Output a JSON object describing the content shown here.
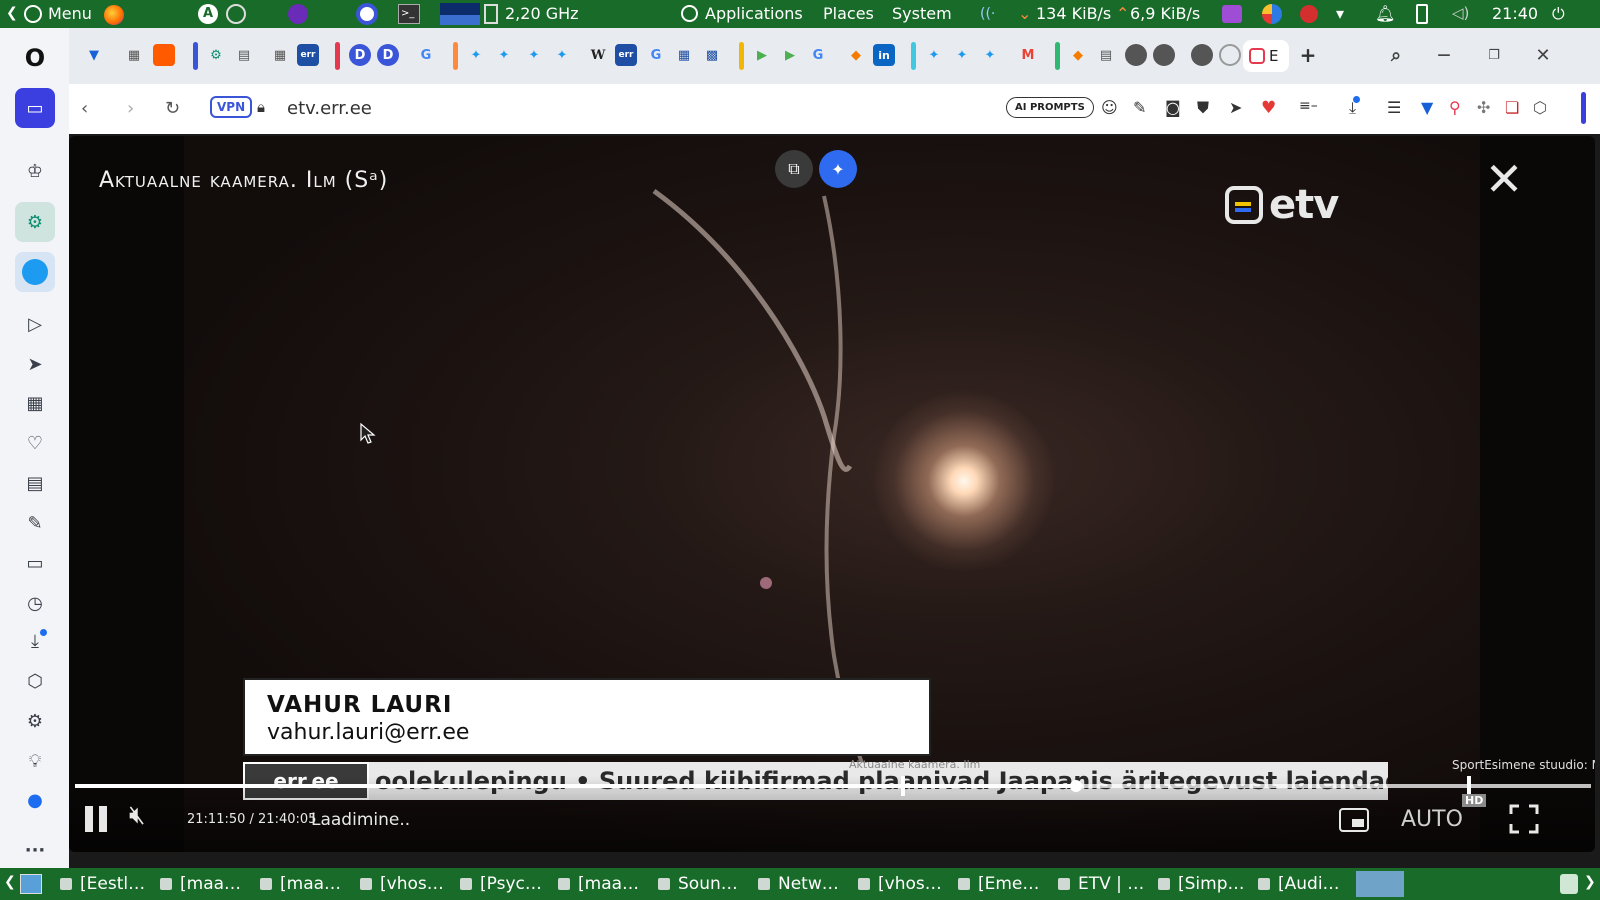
{
  "system_bar": {
    "menu_label": "Menu",
    "cpu_freq": "2,20 GHz",
    "applications": "Applications",
    "places": "Places",
    "system": "System",
    "net_down": "134 KiB/s",
    "net_up": "6,9 KiB/s",
    "clock": "21:40"
  },
  "tabs": {
    "active_tab_label": "E"
  },
  "address_bar": {
    "vpn_label": "VPN",
    "url": "etv.err.ee",
    "ai_prompts_label": "AI PROMPTS"
  },
  "video": {
    "program_title": "Aktuaalne kaamera. Ilm (Sᵃ)",
    "channel_logo": "etv",
    "lower_third": {
      "name": "VAHUR LAURI",
      "email": "vahur.lauri@err.ee"
    },
    "ticker": {
      "source": "err.ee",
      "text": "oolekulepingu   •   Suured kiibifirmad plaanivad Jaapanis äritegevust laiendada"
    },
    "progress_label": "Aktuaalne kaamera. Ilm",
    "next_program_label": "SportEsimene stuudio: M",
    "time_display": "21:11:50 / 21:40:05",
    "status": "Laadimine..",
    "quality": "AUTO",
    "hd_badge": "HD",
    "progress_fraction": 0.66
  },
  "taskbar": {
    "items": [
      "[Eestl…",
      "[maa…",
      "[maa…",
      "[vhos…",
      "[Psyc…",
      "[maa…",
      "Soun…",
      "Netw…",
      "[vhos…",
      "[Eme…",
      "ETV | …",
      "[Simp…",
      "[Audi…"
    ]
  }
}
